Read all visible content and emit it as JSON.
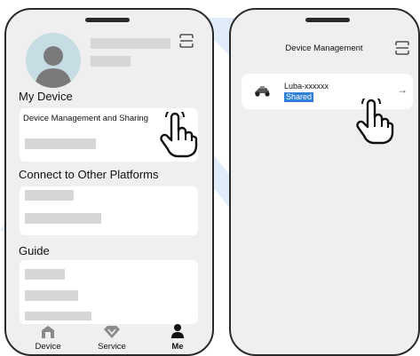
{
  "left_screen": {
    "section_my_device": "My Device",
    "row_device_management": "Device Management and Sharing",
    "section_connect": "Connect to Other Platforms",
    "section_guide": "Guide",
    "tabs": [
      {
        "label": "Device",
        "icon": "home-icon",
        "active": false
      },
      {
        "label": "Service",
        "icon": "diamond-icon",
        "active": false
      },
      {
        "label": "Me",
        "icon": "person-icon",
        "active": true
      }
    ]
  },
  "right_screen": {
    "title": "Device Management",
    "device": {
      "name": "Luba-xxxxxx",
      "status": "Shared",
      "icon": "mower-icon"
    }
  },
  "colors": {
    "accent": "#2f7fd6",
    "watermark": "#4a90e2",
    "avatar": "#c5dde3"
  }
}
